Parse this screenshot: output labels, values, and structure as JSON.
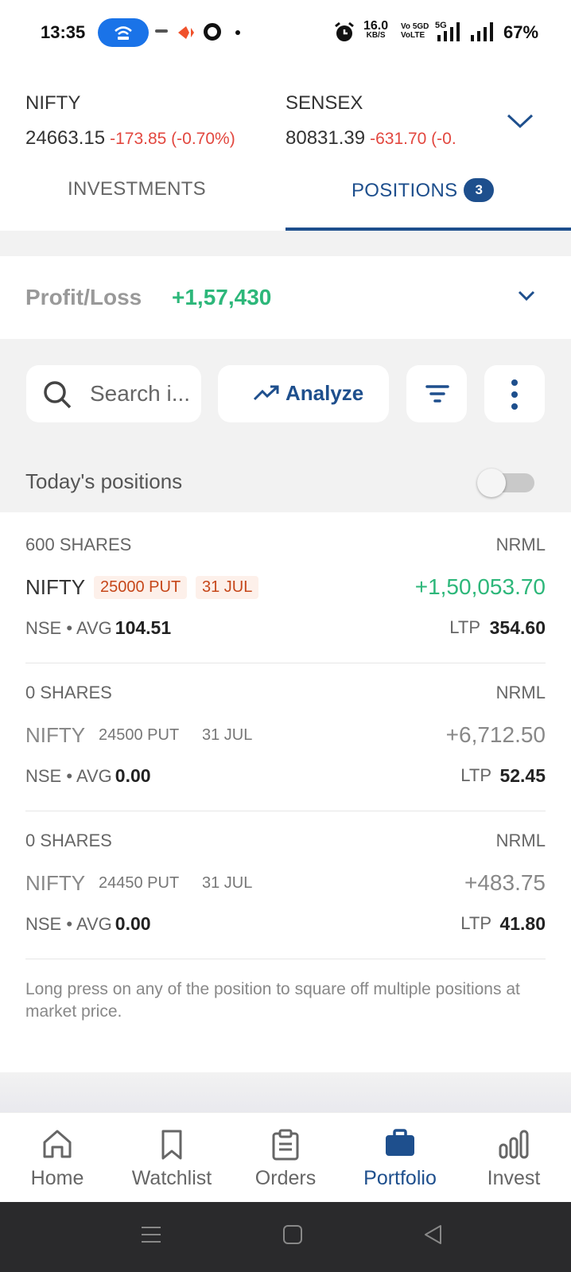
{
  "status_bar": {
    "time": "13:35",
    "speed_value": "16.0",
    "speed_unit": "KB/S",
    "volte_top": "Vo 5GD",
    "volte_bottom": "VoLTE",
    "network": "5G",
    "battery": "67%"
  },
  "indices": [
    {
      "name": "NIFTY",
      "value": "24663.15",
      "change": "-173.85 (-0.70%)"
    },
    {
      "name": "SENSEX",
      "value": "80831.39",
      "change": "-631.70 (-0."
    }
  ],
  "tabs": {
    "investments": "INVESTMENTS",
    "positions": "POSITIONS",
    "positions_count": "3"
  },
  "pnl": {
    "label": "Profit/Loss",
    "value": "+1,57,430"
  },
  "toolbar": {
    "search_placeholder": "Search i...",
    "analyze_label": "Analyze"
  },
  "today_positions_label": "Today's positions",
  "positions": [
    {
      "qty": "600 SHARES",
      "product": "NRML",
      "symbol": "NIFTY",
      "strike": "25000 PUT",
      "expiry": "31 JUL",
      "pnl": "+1,50,053.70",
      "exchange": "NSE",
      "avg_label": "AVG",
      "avg": "104.51",
      "ltp_label": "LTP",
      "ltp": "354.60"
    },
    {
      "qty": "0 SHARES",
      "product": "NRML",
      "symbol": "NIFTY",
      "strike": "24500 PUT",
      "expiry": "31 JUL",
      "pnl": "+6,712.50",
      "exchange": "NSE",
      "avg_label": "AVG",
      "avg": "0.00",
      "ltp_label": "LTP",
      "ltp": "52.45"
    },
    {
      "qty": "0 SHARES",
      "product": "NRML",
      "symbol": "NIFTY",
      "strike": "24450 PUT",
      "expiry": "31 JUL",
      "pnl": "+483.75",
      "exchange": "NSE",
      "avg_label": "AVG",
      "avg": "0.00",
      "ltp_label": "LTP",
      "ltp": "41.80"
    }
  ],
  "hint": "Long press on any of the position to square off multiple positions at market price.",
  "bottom_nav": [
    {
      "label": "Home",
      "icon": "home-icon"
    },
    {
      "label": "Watchlist",
      "icon": "bookmark-icon"
    },
    {
      "label": "Orders",
      "icon": "clipboard-icon"
    },
    {
      "label": "Portfolio",
      "icon": "briefcase-icon",
      "active": true
    },
    {
      "label": "Invest",
      "icon": "bar-chart-icon"
    }
  ],
  "colors": {
    "brand_blue": "#1e4f8d",
    "profit_green": "#2db77a",
    "loss_red": "#e2473f"
  }
}
